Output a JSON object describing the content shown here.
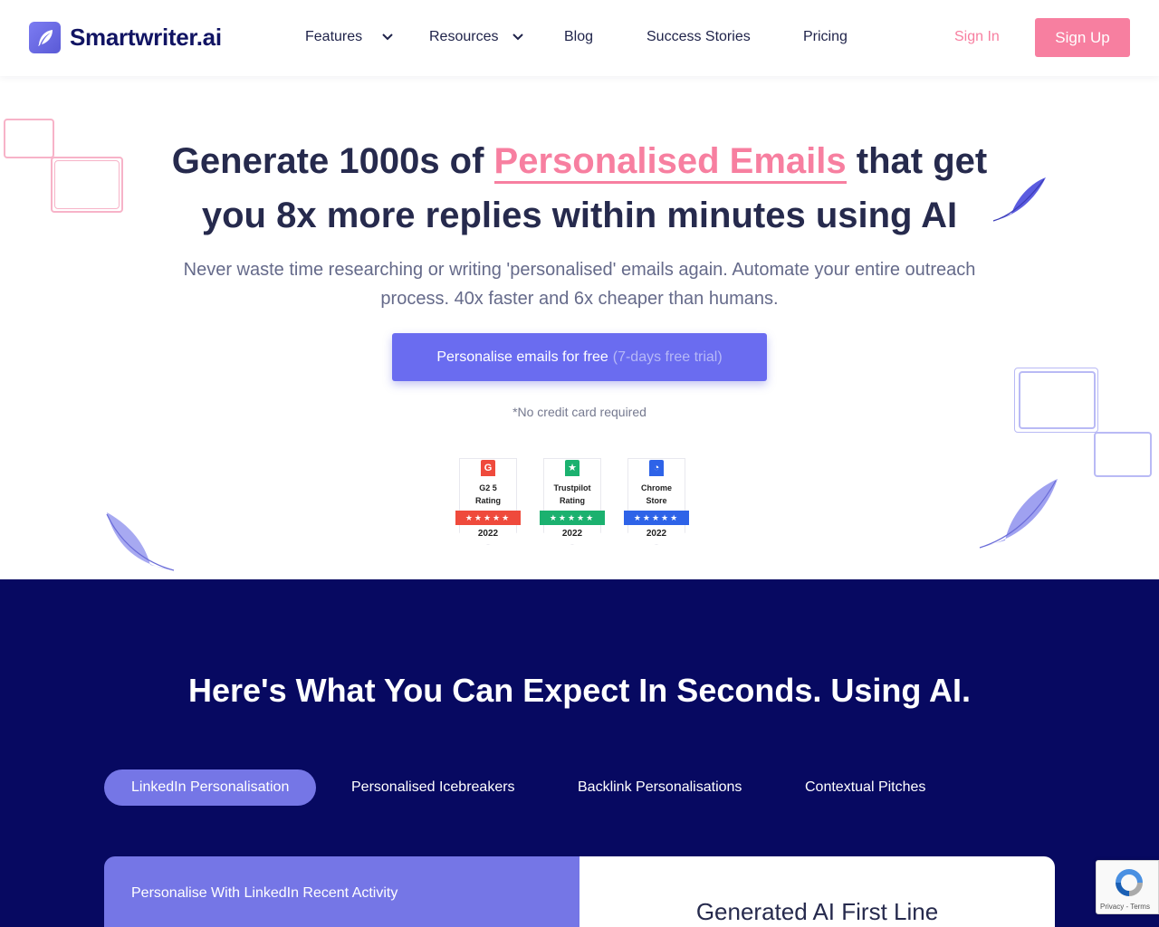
{
  "brand": {
    "name": "Smartwriter.ai",
    "logo_icon": "feather-icon"
  },
  "nav": {
    "items": [
      {
        "label": "Features",
        "has_dropdown": true
      },
      {
        "label": "Resources",
        "has_dropdown": true
      },
      {
        "label": "Blog",
        "has_dropdown": false
      },
      {
        "label": "Success Stories",
        "has_dropdown": false
      },
      {
        "label": "Pricing",
        "has_dropdown": false
      }
    ],
    "sign_in": "Sign In",
    "sign_up": "Sign Up"
  },
  "hero": {
    "title_pre": "Generate 1000s of ",
    "title_highlight": "Personalised Emails",
    "title_post": " that get",
    "title_line2": "you 8x more replies within minutes using AI",
    "subtitle_line1": "Never waste time researching or writing 'personalised' emails again. Automate your entire outreach",
    "subtitle_line2": "process. 40x faster and 6x cheaper than humans.",
    "cta_label": "Personalise emails for free",
    "cta_trial": "(7-days free trial)",
    "no_card": "*No credit card required"
  },
  "badges": [
    {
      "icon_text": "G",
      "line1": "G2 5",
      "line2": "Rating",
      "stars": "★★★★★",
      "year": "2022",
      "color": "#ef4a3c"
    },
    {
      "icon_text": "★",
      "line1": "Trustpilot",
      "line2": "Rating",
      "stars": "★★★★★",
      "year": "2022",
      "color": "#1bb16f"
    },
    {
      "icon_text": "◔",
      "line1": "Chrome",
      "line2": "Store",
      "stars": "★★★★★",
      "year": "2022",
      "color": "#2e63e8"
    }
  ],
  "expect": {
    "title": "Here's What You Can Expect In Seconds. Using AI.",
    "tabs": [
      "LinkedIn Personalisation",
      "Personalised Icebreakers",
      "Backlink Personalisations",
      "Contextual Pitches"
    ],
    "active_tab": 0,
    "left_panel_title": "Personalise With LinkedIn Recent Activity",
    "right_panel_title": "Generated AI First Line"
  },
  "recaptcha": {
    "text": "Privacy - Terms"
  },
  "colors": {
    "accent_pink": "#f77fa0",
    "accent_purple": "#6a6cf0",
    "navy": "#070961"
  }
}
